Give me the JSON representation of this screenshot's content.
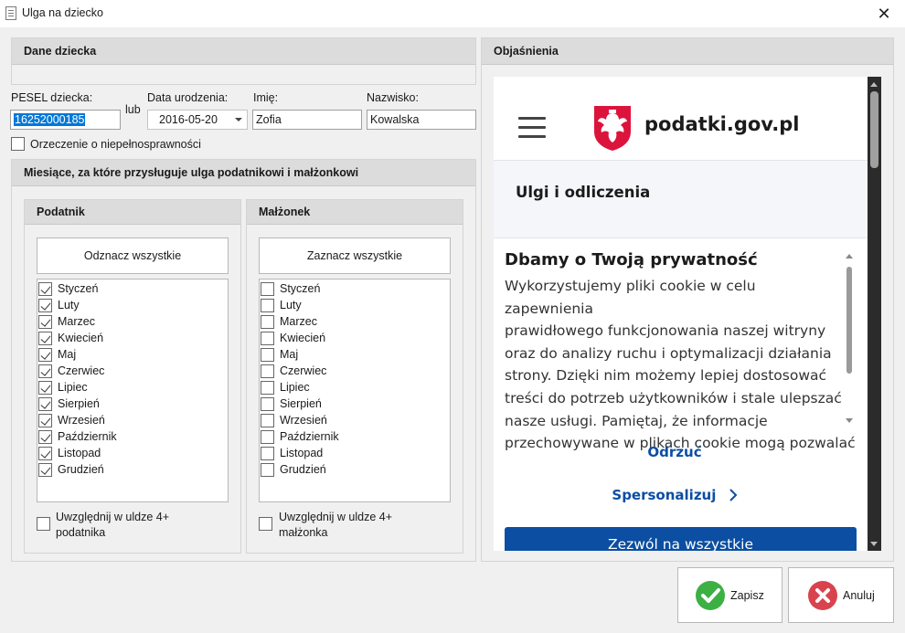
{
  "window": {
    "title": "Ulga na dziecko",
    "close": "✕"
  },
  "dane": {
    "header": "Dane dziecka",
    "pesel_label": "PESEL dziecka:",
    "pesel_value": "16252000185",
    "lub": "lub",
    "birth_label": "Data urodzenia:",
    "birth_value": "2016-05-20",
    "imie_label": "Imię:",
    "imie_value": "Zofia",
    "nazwisko_label": "Nazwisko:",
    "nazwisko_value": "Kowalska",
    "disability_label": "Orzeczenie o niepełnosprawności",
    "disability_checked": false
  },
  "months_section": {
    "header": "Miesiące, za które przysługuje ulga podatnikowi i małżonkowi",
    "podatnik": {
      "header": "Podatnik",
      "toggle_button": "Odznacz wszystkie",
      "checked": [
        true,
        true,
        true,
        true,
        true,
        true,
        true,
        true,
        true,
        true,
        true,
        true
      ],
      "extra_label_1": "Uwzględnij w uldze 4+",
      "extra_label_2": "podatnika"
    },
    "malzonek": {
      "header": "Małżonek",
      "toggle_button": "Zaznacz wszystkie",
      "checked": [
        false,
        false,
        false,
        false,
        false,
        false,
        false,
        false,
        false,
        false,
        false,
        false
      ],
      "extra_label_1": "Uwzględnij w uldze 4+",
      "extra_label_2": "małżonka"
    },
    "months": [
      "Styczeń",
      "Luty",
      "Marzec",
      "Kwiecień",
      "Maj",
      "Czerwiec",
      "Lipiec",
      "Sierpień",
      "Wrzesień",
      "Październik",
      "Listopad",
      "Grudzień"
    ]
  },
  "explanations": {
    "header": "Objaśnienia",
    "site_title": "podatki.gov.pl",
    "section_title": "Ulgi i odliczenia",
    "cookie_title": "Dbamy o Twoją prywatność",
    "cookie_lines": [
      "Wykorzystujemy pliki cookie w celu zapewnienia",
      "prawidłowego funkcjonowania naszej witryny",
      "oraz do analizy ruchu i optymalizacji działania",
      "strony. Dzięki nim możemy lepiej dostosować",
      "treści do potrzeb użytkowników i stale ulepszać",
      "nasze usługi. Pamiętaj, że informacje",
      "przechowywane w plikach cookie mogą pozwalać"
    ],
    "reject": "Odrzuć",
    "personalize": "Spersonalizuj",
    "allow_all": "Zezwól na wszystkie"
  },
  "actions": {
    "save": "Zapisz",
    "cancel": "Anuluj"
  },
  "colors": {
    "accent_blue": "#0b4ea2",
    "selection": "#0078d7",
    "save_green": "#3cb043",
    "cancel_red": "#d9434e",
    "emblem_red": "#dc143c"
  }
}
